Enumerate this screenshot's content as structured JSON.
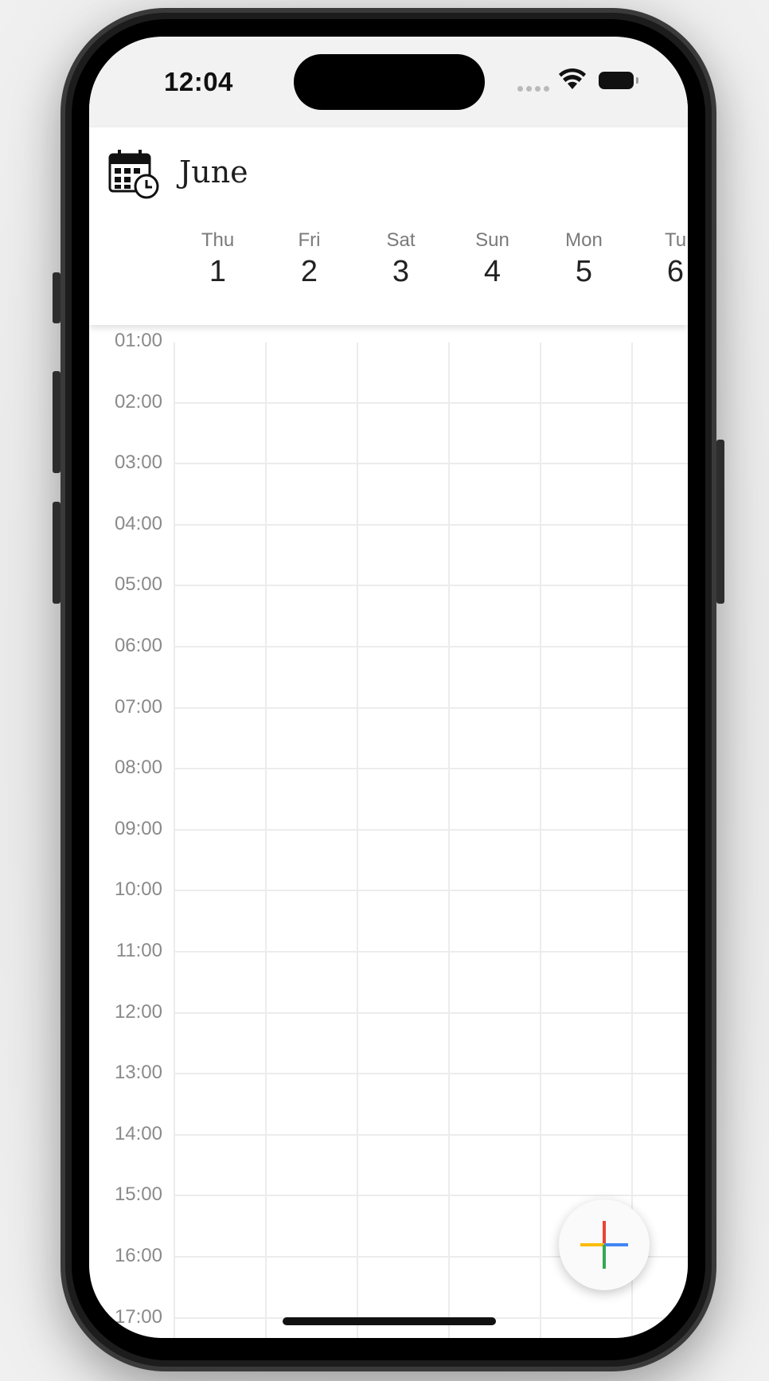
{
  "status_bar": {
    "time": "12:04",
    "icons": [
      "signal-dots-icon",
      "wifi-icon",
      "battery-icon"
    ]
  },
  "header": {
    "app_icon": "calendar-clock-icon",
    "month": "June",
    "days": [
      {
        "dow": "Thu",
        "num": "1"
      },
      {
        "dow": "Fri",
        "num": "2"
      },
      {
        "dow": "Sat",
        "num": "3"
      },
      {
        "dow": "Sun",
        "num": "4"
      },
      {
        "dow": "Mon",
        "num": "5"
      },
      {
        "dow": "Tu",
        "num": "6"
      }
    ]
  },
  "timeline": {
    "hours": [
      "01:00",
      "02:00",
      "03:00",
      "04:00",
      "05:00",
      "06:00",
      "07:00",
      "08:00",
      "09:00",
      "10:00",
      "11:00",
      "12:00",
      "13:00",
      "14:00",
      "15:00",
      "16:00",
      "17:00"
    ]
  },
  "fab": {
    "icon": "add-plus-icon",
    "colors": {
      "red": "#ea4335",
      "blue": "#4285f4",
      "yellow": "#fbbc05",
      "green": "#34a853"
    }
  }
}
